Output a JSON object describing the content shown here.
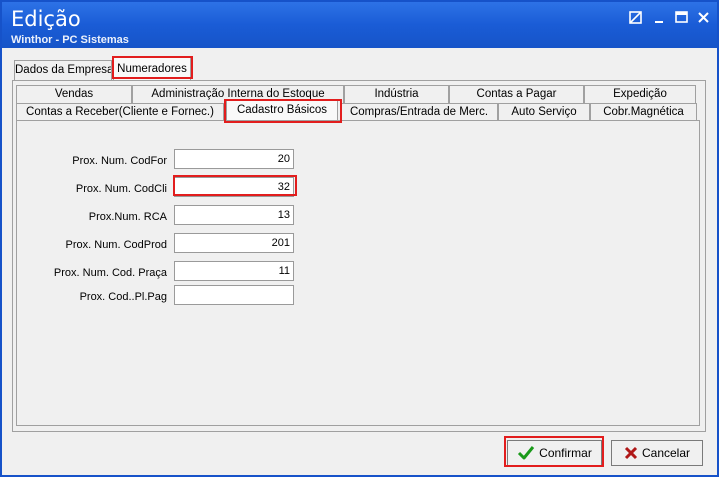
{
  "window": {
    "title": "Edição",
    "subtitle": "Winthor - PC Sistemas"
  },
  "titlebar_icons": [
    "restore-icon",
    "minimize-icon",
    "maximize-icon",
    "close-icon"
  ],
  "top_tabs": [
    {
      "label": "Dados da Empresa"
    },
    {
      "label": "Numeradores"
    }
  ],
  "tabs_row1": [
    {
      "label": "Vendas"
    },
    {
      "label": "Administração Interna do Estoque"
    },
    {
      "label": "Indústria"
    },
    {
      "label": "Contas a Pagar"
    },
    {
      "label": "Expedição"
    }
  ],
  "tabs_row2": [
    {
      "label": "Contas a Receber(Cliente e Fornec.)"
    },
    {
      "label": "Cadastro Básicos"
    },
    {
      "label": "Compras/Entrada de Merc."
    },
    {
      "label": "Auto Serviço"
    },
    {
      "label": "Cobr.Magnética"
    }
  ],
  "form": {
    "fields": [
      {
        "label": "Prox. Num. CodFor",
        "value": "20"
      },
      {
        "label": "Prox. Num. CodCli",
        "value": "32"
      },
      {
        "label": "Prox.Num. RCA",
        "value": "13"
      },
      {
        "label": "Prox. Num. CodProd",
        "value": "201"
      },
      {
        "label": "Prox. Num. Cod. Praça",
        "value": "11"
      },
      {
        "label": "Prox. Cod..Pl.Pag",
        "value": ""
      }
    ]
  },
  "buttons": {
    "confirm": "Confirmar",
    "cancel": "Cancelar"
  },
  "colors": {
    "titlebar": "#1a5cd6",
    "highlight": "#e21d1d",
    "confirm_icon": "#1a9a1a",
    "cancel_icon": "#b01818"
  }
}
